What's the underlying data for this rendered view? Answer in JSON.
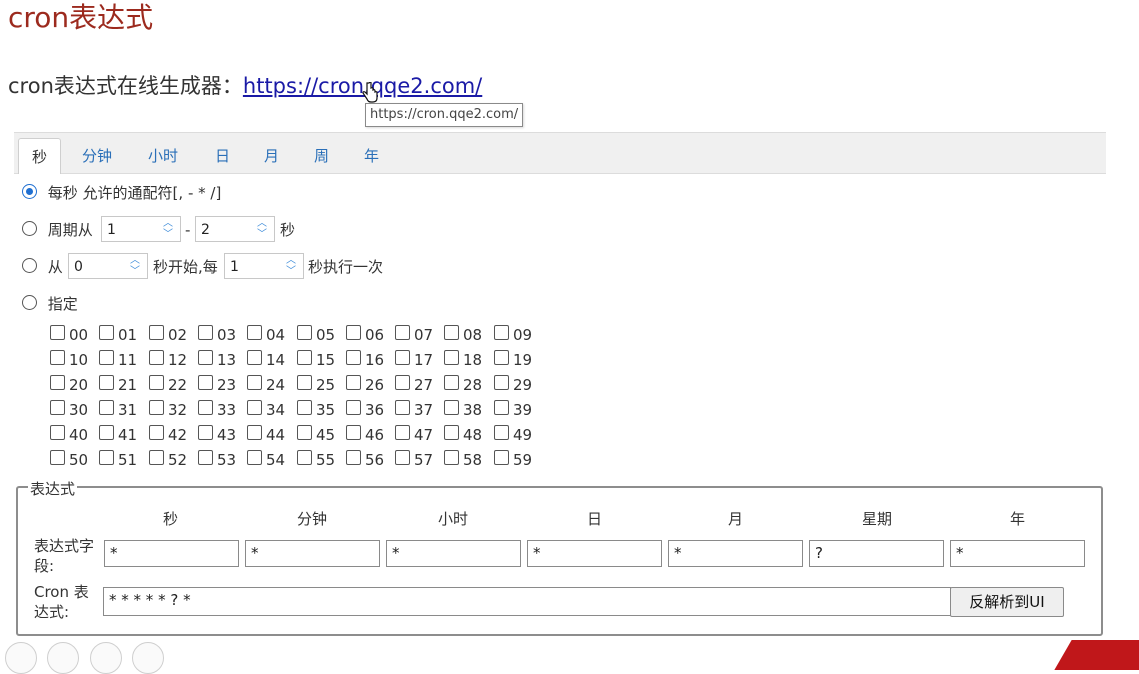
{
  "title": "cron表达式",
  "subtitle": {
    "prefix": "cron表达式在线生成器：",
    "link_text": "https://cron.qqe2.com/",
    "tooltip": "https://cron.qqe2.com/"
  },
  "tabs": [
    {
      "label": "秒",
      "active": true
    },
    {
      "label": "分钟",
      "active": false
    },
    {
      "label": "小时",
      "active": false
    },
    {
      "label": "日",
      "active": false
    },
    {
      "label": "月",
      "active": false
    },
    {
      "label": "周",
      "active": false
    },
    {
      "label": "年",
      "active": false
    }
  ],
  "options": {
    "every": {
      "label": "每秒 允许的通配符[, - * /]",
      "checked": true
    },
    "period": {
      "prefix": "周期从",
      "from": "1",
      "separator": "-",
      "to": "2",
      "suffix": "秒",
      "checked": false
    },
    "start": {
      "prefix": "从",
      "start": "0",
      "middle": "秒开始,每",
      "every": "1",
      "suffix": "秒执行一次",
      "checked": false
    },
    "specify": {
      "label": "指定",
      "checked": false
    }
  },
  "seconds": [
    [
      "00",
      "01",
      "02",
      "03",
      "04",
      "05",
      "06",
      "07",
      "08",
      "09"
    ],
    [
      "10",
      "11",
      "12",
      "13",
      "14",
      "15",
      "16",
      "17",
      "18",
      "19"
    ],
    [
      "20",
      "21",
      "22",
      "23",
      "24",
      "25",
      "26",
      "27",
      "28",
      "29"
    ],
    [
      "30",
      "31",
      "32",
      "33",
      "34",
      "35",
      "36",
      "37",
      "38",
      "39"
    ],
    [
      "40",
      "41",
      "42",
      "43",
      "44",
      "45",
      "46",
      "47",
      "48",
      "49"
    ],
    [
      "50",
      "51",
      "52",
      "53",
      "54",
      "55",
      "56",
      "57",
      "58",
      "59"
    ]
  ],
  "expression": {
    "legend": "表达式",
    "columns": [
      "秒",
      "分钟",
      "小时",
      "日",
      "月",
      "星期",
      "年"
    ],
    "field_label": "表达式字段:",
    "field_values": [
      "*",
      "*",
      "*",
      "*",
      "*",
      "?",
      "*"
    ],
    "cron_label": "Cron 表达式:",
    "cron_value": "* * * * * ? *",
    "reverse_button": "反解析到UI"
  }
}
